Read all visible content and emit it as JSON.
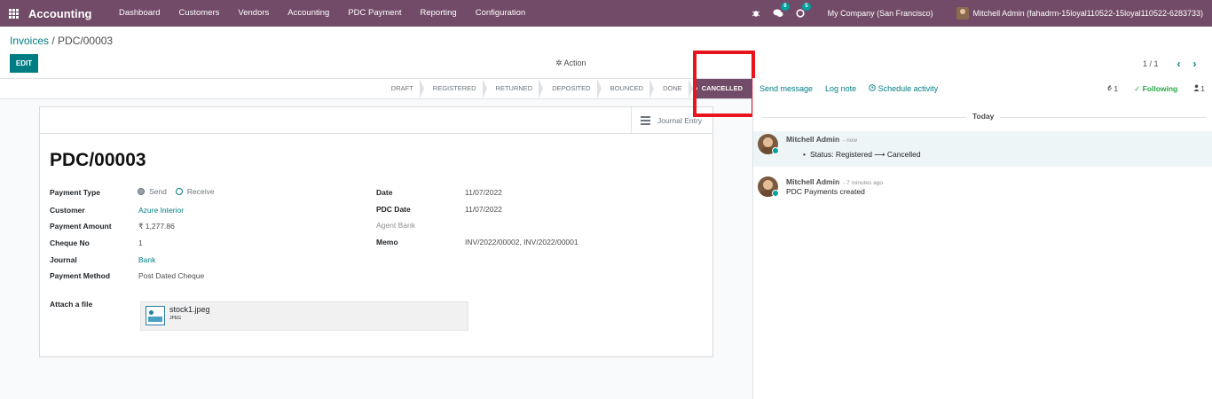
{
  "navbar": {
    "brand": "Accounting",
    "menu": [
      "Dashboard",
      "Customers",
      "Vendors",
      "Accounting",
      "PDC Payment",
      "Reporting",
      "Configuration"
    ],
    "messages_badge": "6",
    "activities_badge": "5",
    "company": "My Company (San Francisco)",
    "user": "Mitchell Admin (fahadrm-15loyal110522-15loyal110522-6283733)"
  },
  "breadcrumb": {
    "parent": "Invoices",
    "separator": " / ",
    "current": "PDC/00003"
  },
  "toolbar": {
    "edit_label": "EDIT",
    "action_label": "✲ Action",
    "pager": "1 / 1",
    "prev": "‹",
    "next": "›"
  },
  "statusbar": {
    "steps": [
      "DRAFT",
      "REGISTERED",
      "RETURNED",
      "DEPOSITED",
      "BOUNCED",
      "DONE",
      "CANCELLED"
    ],
    "active": "CANCELLED"
  },
  "form": {
    "journal_entry_label": "Journal Entry",
    "name": "PDC/00003",
    "payment_type_label": "Payment Type",
    "payment_type_options": [
      "Send",
      "Receive"
    ],
    "customer_label": "Customer",
    "customer": "Azure Interior",
    "payment_amount_label": "Payment Amount",
    "payment_amount": "₹ 1,277.86",
    "cheque_no_label": "Cheque No",
    "cheque_no": "1",
    "journal_label": "Journal",
    "journal": "Bank",
    "payment_method_label": "Payment Method",
    "payment_method": "Post Dated Cheque",
    "date_label": "Date",
    "date": "11/07/2022",
    "pdc_date_label": "PDC Date",
    "pdc_date": "11/07/2022",
    "agent_bank_label": "Agent Bank",
    "memo_label": "Memo",
    "memo": "INV/2022/00002, INV/2022/00001",
    "attach_label": "Attach a file",
    "attachment_name": "stock1.jpeg",
    "attachment_type": "JPEG"
  },
  "chatter": {
    "send_message": "Send message",
    "log_note": "Log note",
    "schedule_activity": "Schedule activity",
    "attachments_count": "1",
    "following": "Following",
    "followers_count": "1",
    "date_separator": "Today",
    "messages": [
      {
        "author": "Mitchell Admin",
        "time": "- now",
        "body": "Status: Registered ⟶ Cancelled"
      },
      {
        "author": "Mitchell Admin",
        "time": "- 7 minutes ago",
        "body": "PDC Payments created"
      }
    ]
  },
  "colors": {
    "brand": "#714B67",
    "accent": "#017e84",
    "highlight": "#e8151e"
  }
}
